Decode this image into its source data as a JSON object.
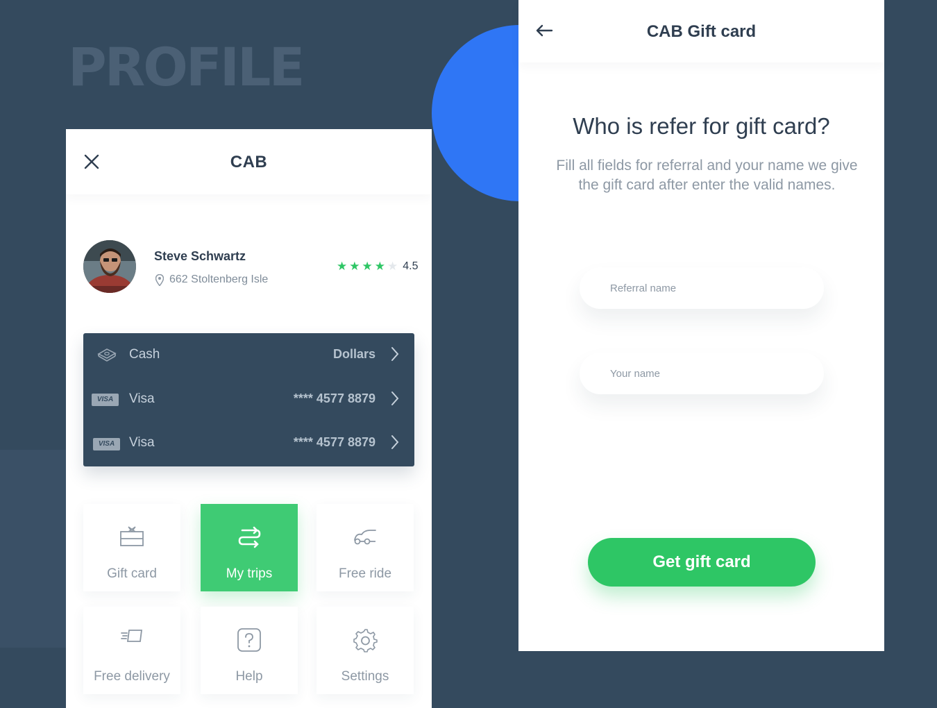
{
  "background": {
    "title": "PROFILE",
    "accent_circle_color": "#2f76f5"
  },
  "left_screen": {
    "header": {
      "title": "CAB",
      "close_icon": "close-icon"
    },
    "profile": {
      "name": "Steve Schwartz",
      "address": "662 Stoltenberg Isle",
      "rating": 4.5,
      "rating_text": "4.5",
      "stars_filled": 4,
      "stars_total": 5
    },
    "payments": [
      {
        "label": "Cash",
        "value": "Dollars",
        "icon": "cash-icon"
      },
      {
        "label": "Visa",
        "value": "**** 4577 8879",
        "icon": "visa-icon",
        "badge": "VISA"
      },
      {
        "label": "Visa",
        "value": "**** 4577 8879",
        "icon": "visa-icon",
        "badge": "VISA"
      }
    ],
    "menu": [
      {
        "label": "Gift card",
        "icon": "gift-icon",
        "active": false
      },
      {
        "label": "My trips",
        "icon": "route-icon",
        "active": true
      },
      {
        "label": "Free ride",
        "icon": "ride-icon",
        "active": false
      },
      {
        "label": "Free delivery",
        "icon": "delivery-icon",
        "active": false
      },
      {
        "label": "Help",
        "icon": "help-icon",
        "active": false
      },
      {
        "label": "Settings",
        "icon": "gear-icon",
        "active": false
      }
    ]
  },
  "right_screen": {
    "header": {
      "title": "CAB Gift card",
      "back_icon": "arrow-left-icon"
    },
    "question": "Who is refer for gift card?",
    "description": "Fill all fields for referral and your name we give the gift card after enter the valid names.",
    "fields": [
      {
        "placeholder": "Referral name",
        "value": ""
      },
      {
        "placeholder": "Your name",
        "value": ""
      }
    ],
    "cta": "Get gift card"
  },
  "colors": {
    "background": "#344a5e",
    "accent_green": "#3fcb74",
    "star_green": "#2ec665",
    "text_dark": "#2f3e50",
    "text_muted": "#8d98a4"
  }
}
